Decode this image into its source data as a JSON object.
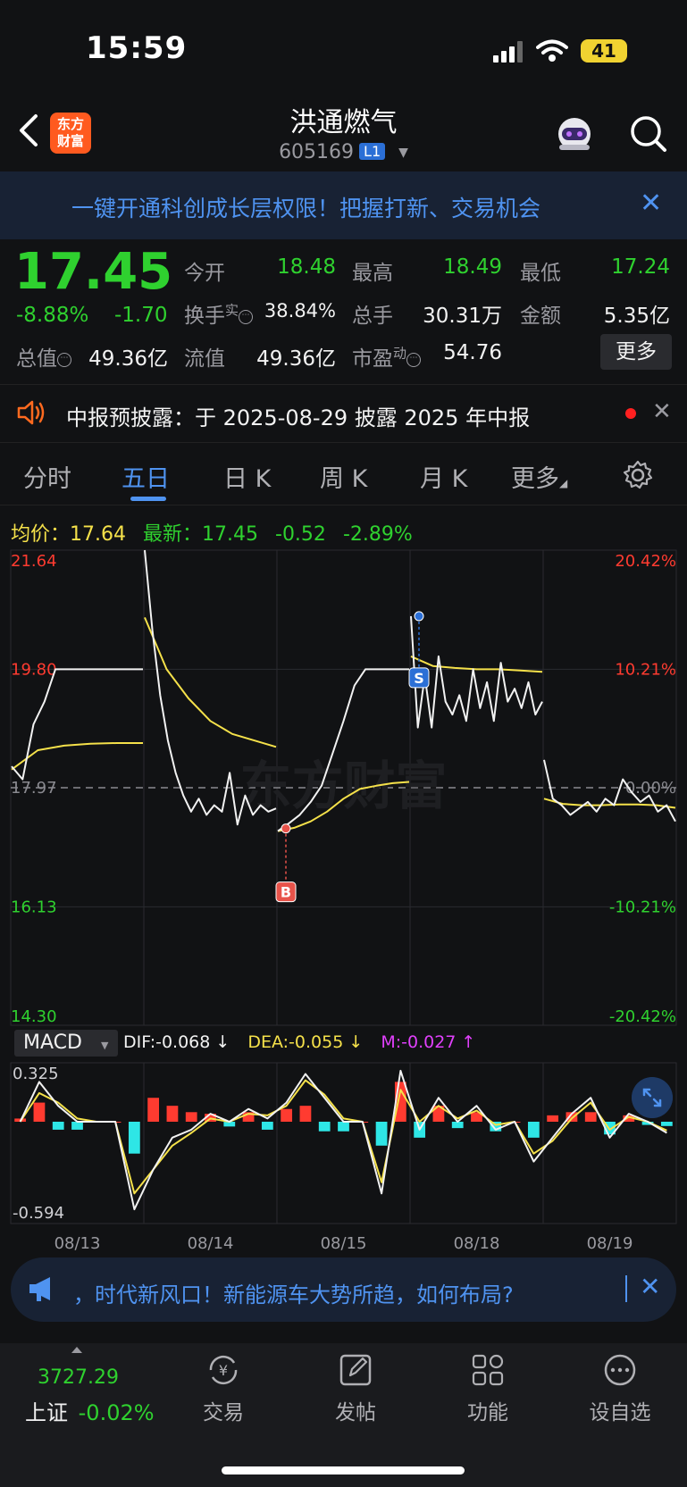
{
  "status_bar": {
    "time": "15:59",
    "battery": "41"
  },
  "header": {
    "logo_line1": "东方",
    "logo_line2": "财富",
    "title": "洪通燃气",
    "code": "605169",
    "level_badge": "L1"
  },
  "promo_banner": {
    "text": "一键开通科创成长层权限！把握打新、交易机会",
    "close": "✕"
  },
  "quote": {
    "price": "17.45",
    "change_pct": "-8.88%",
    "change": "-1.70",
    "open_label": "今开",
    "open": "18.48",
    "high_label": "最高",
    "high": "18.49",
    "low_label": "最低",
    "low": "17.24",
    "turnover_label": "换手",
    "turnover_sup": "实",
    "turnover": "38.84%",
    "volume_label": "总手",
    "volume": "30.31万",
    "amount_label": "金额",
    "amount": "5.35亿",
    "mcap_label": "总值",
    "mcap": "49.36亿",
    "float_label": "流值",
    "float": "49.36亿",
    "pe_label": "市盈",
    "pe_sup": "动",
    "pe": "54.76",
    "more": "更多"
  },
  "notice": {
    "text": "中报预披露：于 2025-08-29 披露 2025 年中报",
    "close": "✕"
  },
  "tabs": [
    {
      "label": "分时",
      "active": false
    },
    {
      "label": "五日",
      "active": true
    },
    {
      "label": "日 K",
      "active": false
    },
    {
      "label": "周 K",
      "active": false
    },
    {
      "label": "月 K",
      "active": false
    },
    {
      "label": "更多",
      "active": false
    }
  ],
  "avg_row": {
    "avg_label": "均价：",
    "avg": "17.64",
    "latest_label": "最新：",
    "latest": "17.45",
    "diff": "-0.52",
    "diff_pct": "-2.89%"
  },
  "chart_data": {
    "type": "line",
    "y_ticks_left": [
      "21.64",
      "19.80",
      "17.97",
      "16.13",
      "14.30"
    ],
    "y_ticks_right": [
      "20.42%",
      "10.21%",
      "0.00%",
      "-10.21%",
      "-20.42%"
    ],
    "ylim": [
      14.3,
      21.64
    ],
    "prev_close": 17.97,
    "x_labels": [
      "08/13",
      "08/14",
      "08/15",
      "08/18",
      "08/19"
    ],
    "watermark": "东方财富",
    "markers": [
      {
        "label": "B",
        "day": 2,
        "price": 17.34
      },
      {
        "label": "S",
        "day": 3,
        "price": 20.62
      }
    ],
    "series": [
      {
        "name": "price",
        "days": [
          [
            18.3,
            18.1,
            18.95,
            19.3,
            19.8,
            19.8,
            19.8,
            19.8,
            19.8,
            19.8,
            19.8,
            19.8,
            19.8
          ],
          [
            21.64,
            20.4,
            19.4,
            18.7,
            18.2,
            17.85,
            17.6,
            17.8,
            17.55,
            17.7,
            17.6,
            18.2,
            17.4,
            17.85,
            17.55,
            17.7,
            17.6,
            17.65
          ],
          [
            17.3,
            17.42,
            17.55,
            17.75,
            18.0,
            18.5,
            19.0,
            19.55,
            19.8,
            19.8,
            19.8,
            19.8,
            19.8
          ],
          [
            20.62,
            18.9,
            19.7,
            18.9,
            20.0,
            19.3,
            19.1,
            19.4,
            19.0,
            19.8,
            19.2,
            19.6,
            19.0,
            19.9,
            19.3,
            19.5,
            19.2,
            19.6,
            19.1,
            19.3
          ],
          [
            18.4,
            17.8,
            17.7,
            17.55,
            17.65,
            17.75,
            17.6,
            17.8,
            17.7,
            18.1,
            17.9,
            17.75,
            17.85,
            17.6,
            17.7,
            17.45
          ]
        ]
      },
      {
        "name": "avg",
        "days": [
          [
            18.25,
            18.55,
            18.62,
            18.65,
            18.66,
            18.66
          ],
          [
            20.6,
            19.8,
            19.35,
            19.0,
            18.8,
            18.7,
            18.6
          ],
          [
            17.3,
            17.35,
            17.45,
            17.6,
            17.8,
            17.95,
            18.0,
            18.04,
            18.06
          ],
          [
            20.0,
            19.85,
            19.82,
            19.8,
            19.8,
            19.78,
            19.76
          ],
          [
            17.8,
            17.72,
            17.7,
            17.7,
            17.71,
            17.71,
            17.7,
            17.66
          ]
        ]
      }
    ]
  },
  "macd": {
    "label": "MACD",
    "dif": "DIF:-0.068 ↓",
    "dea": "DEA:-0.055 ↓",
    "m": "M:-0.027 ↑",
    "y_max_label": "0.325",
    "y_min_label": "-0.594",
    "ylim": [
      -0.594,
      0.325
    ],
    "dif_values": [
      0.0,
      0.25,
      0.1,
      0.0,
      0.0,
      0.0,
      -0.55,
      -0.3,
      -0.1,
      -0.05,
      0.05,
      0.0,
      0.08,
      0.02,
      0.12,
      0.3,
      0.15,
      0.0,
      0.0,
      -0.45,
      0.32,
      -0.05,
      0.15,
      0.0,
      0.1,
      -0.05,
      0.0,
      -0.25,
      -0.1,
      0.05,
      0.15,
      -0.1,
      0.05,
      0.0,
      -0.07
    ],
    "dea_values": [
      0.0,
      0.18,
      0.12,
      0.02,
      0.0,
      0.0,
      -0.45,
      -0.3,
      -0.15,
      -0.07,
      0.02,
      0.0,
      0.05,
      0.04,
      0.1,
      0.26,
      0.17,
      0.02,
      0.0,
      -0.38,
      0.2,
      0.0,
      0.1,
      0.02,
      0.07,
      -0.02,
      0.0,
      -0.2,
      -0.12,
      0.02,
      0.12,
      -0.05,
      0.03,
      0.0,
      -0.055
    ],
    "hist_values": [
      0.02,
      0.12,
      -0.05,
      -0.05,
      0.0,
      0.0,
      -0.2,
      0.15,
      0.1,
      0.06,
      0.05,
      -0.03,
      0.06,
      -0.05,
      0.08,
      0.1,
      -0.06,
      -0.06,
      0.0,
      -0.15,
      0.25,
      -0.1,
      0.1,
      -0.04,
      0.06,
      -0.06,
      0.0,
      -0.1,
      0.04,
      0.06,
      0.06,
      -0.08,
      0.04,
      -0.02,
      -0.027
    ]
  },
  "ad_banner": {
    "text": "，时代新风口！新能源车大势所趋，如何布局?",
    "close": "✕"
  },
  "bottom_bar": {
    "index_value": "3727.29",
    "index_name": "上证",
    "index_change": "-0.02%",
    "items": [
      {
        "label": "交易",
        "icon": "trade-icon"
      },
      {
        "label": "发帖",
        "icon": "compose-icon"
      },
      {
        "label": "功能",
        "icon": "grid-icon"
      },
      {
        "label": "设自选",
        "icon": "more-dots-icon"
      }
    ]
  },
  "colors": {
    "up": "#ff3b30",
    "down": "#2fd12f",
    "avg_line": "#f5e14a",
    "accent": "#4f93f0",
    "dea": "#f5e14a",
    "macd_m": "#e040fb"
  }
}
